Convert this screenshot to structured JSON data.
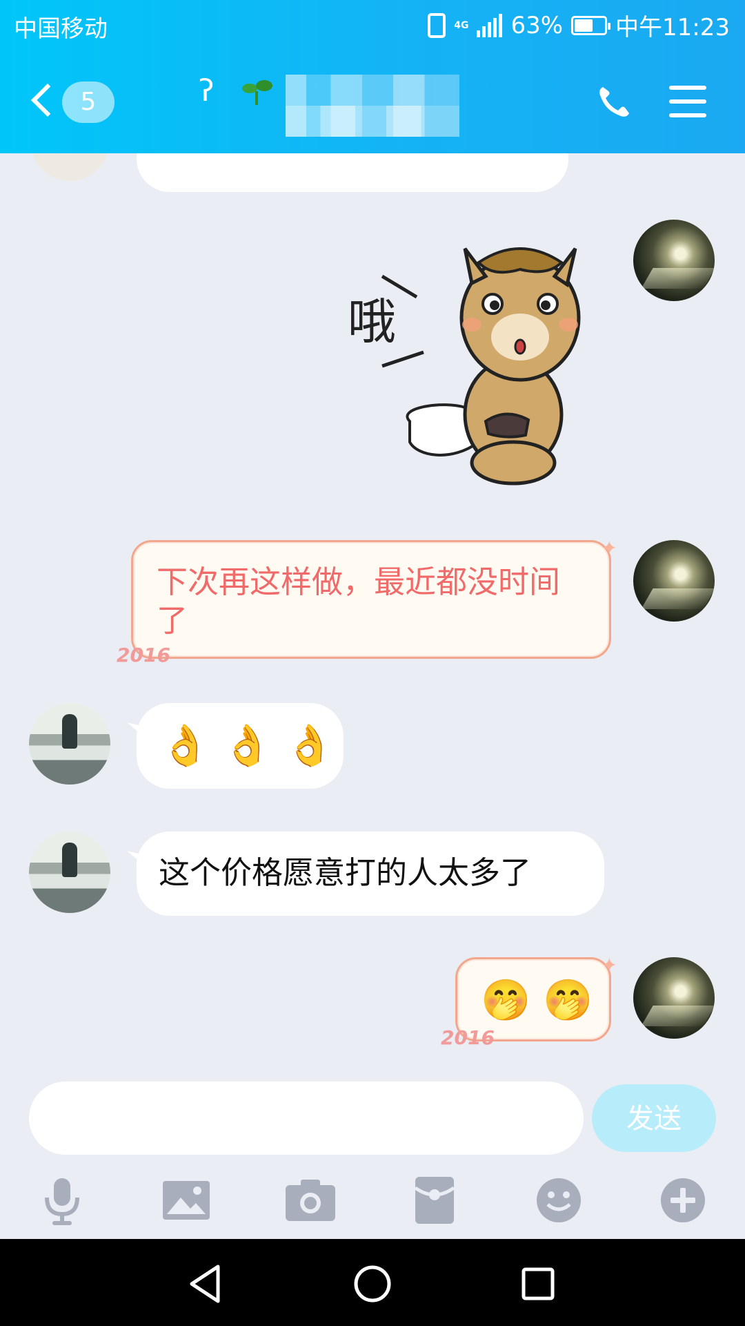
{
  "status_bar": {
    "carrier": "中国移动",
    "network": "4G",
    "battery_percent": "63%",
    "battery_level": 0.63,
    "time": "中午11:23"
  },
  "header": {
    "back_badge": "5",
    "icons": [
      "ear-icon",
      "sprout-icon",
      "phone-icon",
      "menu-icon"
    ]
  },
  "messages": [
    {
      "side": "other",
      "type": "text",
      "text": "",
      "partial": true
    },
    {
      "side": "self",
      "type": "sticker",
      "sticker_text": "哦"
    },
    {
      "side": "self",
      "type": "text",
      "text": "下次再这样做，最近都没时间了",
      "stamp": "2016"
    },
    {
      "side": "other",
      "type": "emoji",
      "emoji": [
        "👌",
        "👌",
        "👌"
      ]
    },
    {
      "side": "other",
      "type": "text",
      "text": "这个价格愿意打的人太多了"
    },
    {
      "side": "self",
      "type": "emoji",
      "emoji": [
        "🤭",
        "🤭"
      ],
      "stamp": "2016"
    }
  ],
  "input": {
    "value": "",
    "send_label": "发送"
  },
  "toolbar": {
    "icons": [
      "microphone-icon",
      "image-icon",
      "camera-icon",
      "red-packet-icon",
      "emoji-icon",
      "plus-icon"
    ]
  },
  "colors": {
    "header_start": "#00c6f8",
    "header_end": "#1aa9f2",
    "chat_bg": "#eaedf4",
    "self_text": "#f06a6a",
    "send_button": "#b7ecfb"
  }
}
